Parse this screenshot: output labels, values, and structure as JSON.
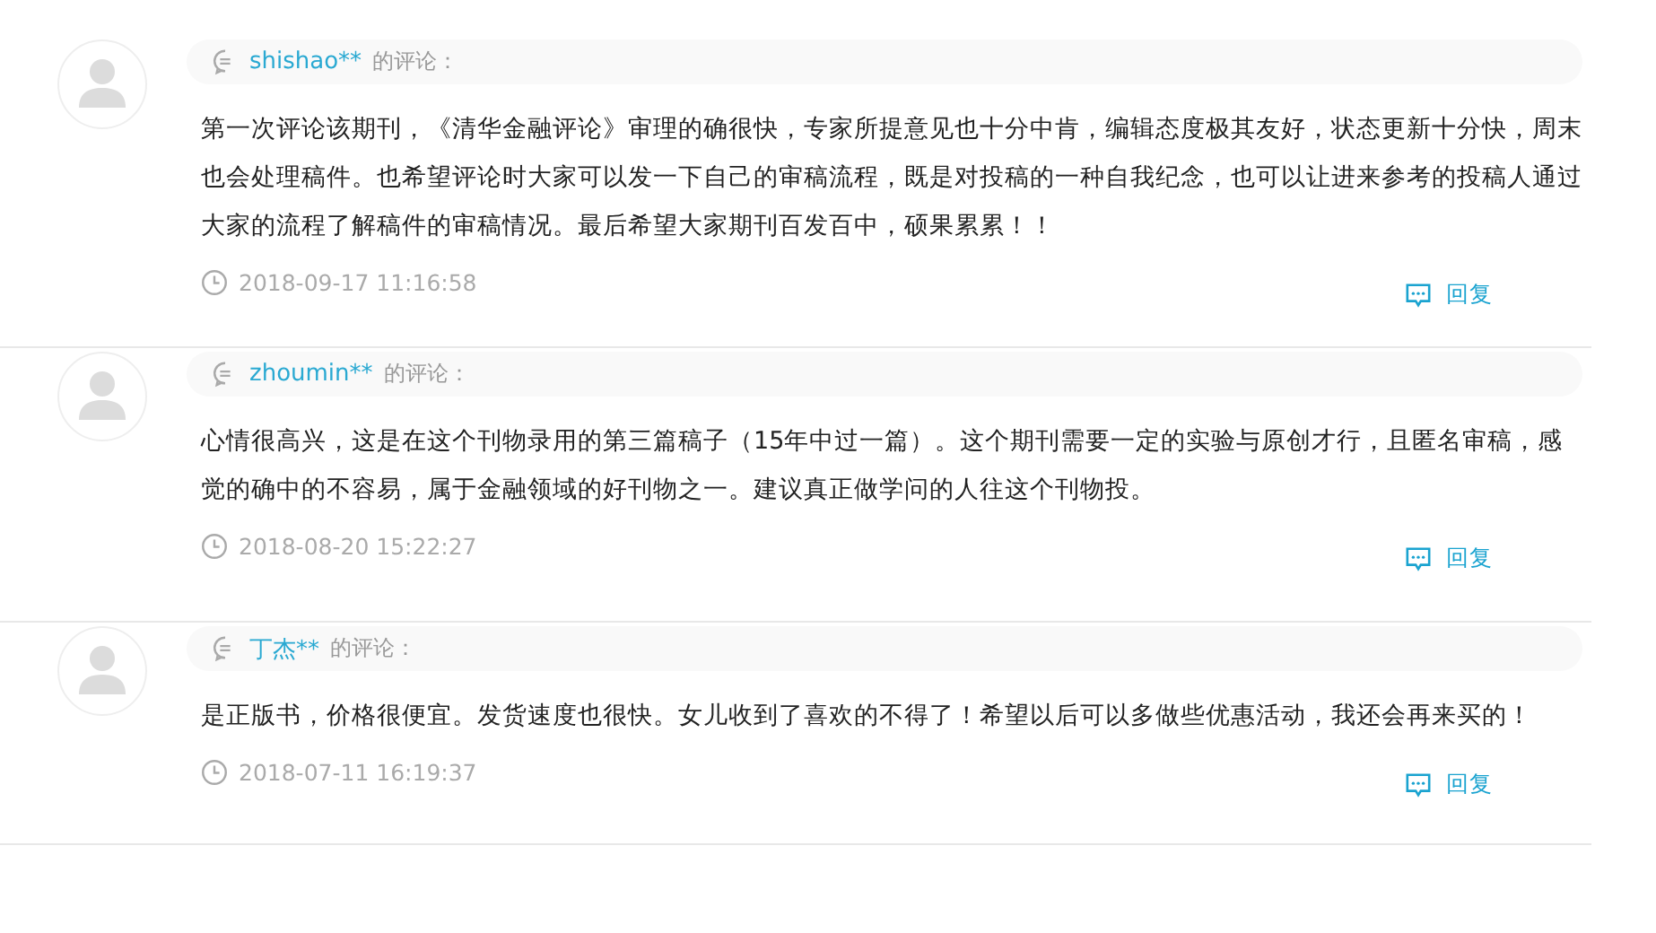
{
  "comments": [
    {
      "user": "shishao**",
      "suffix": "的评论：",
      "text": "第一次评论该期刊，《清华金融评论》审理的确很快，专家所提意见也十分中肯，编辑态度极其友好，状态更新十分快，周末也会处理稿件。也希望评论时大家可以发一下自己的审稿流程，既是对投稿的一种自我纪念，也可以让进来参考的投稿人通过大家的流程了解稿件的审稿情况。最后希望大家期刊百发百中，硕果累累！！",
      "time": "2018-09-17 11:16:58",
      "reply": "回复"
    },
    {
      "user": "zhoumin**",
      "suffix": "的评论：",
      "text": "心情很高兴，这是在这个刊物录用的第三篇稿子（15年中过一篇）。这个期刊需要一定的实验与原创才行，且匿名审稿，感觉的确中的不容易，属于金融领域的好刊物之一。建议真正做学问的人往这个刊物投。",
      "time": "2018-08-20 15:22:27",
      "reply": "回复"
    },
    {
      "user": "丁杰**",
      "suffix": "的评论：",
      "text": "是正版书，价格很便宜。发货速度也很快。女儿收到了喜欢的不得了！希望以后可以多做些优惠活动，我还会再来买的！",
      "time": "2018-07-11 16:19:37",
      "reply": "回复"
    }
  ]
}
